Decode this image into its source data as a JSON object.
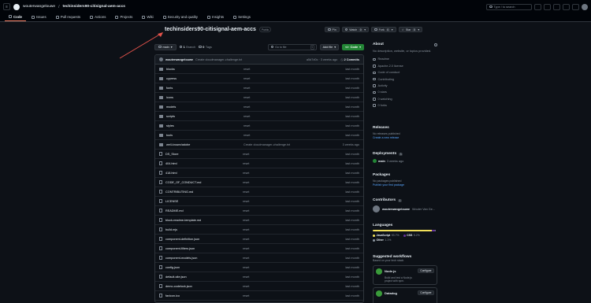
{
  "topbar": {
    "owner": "wouterwangelouwe",
    "repo": "techinsiders90-citisignal-aem-accs",
    "search_placeholder": "Type / to search"
  },
  "tabs": [
    {
      "label": "Code",
      "icon": "code-icon",
      "active": true
    },
    {
      "label": "Issues",
      "icon": "issue-icon"
    },
    {
      "label": "Pull requests",
      "icon": "pull-request-icon"
    },
    {
      "label": "Actions",
      "icon": "actions-icon"
    },
    {
      "label": "Projects",
      "icon": "projects-icon"
    },
    {
      "label": "Wiki",
      "icon": "wiki-icon"
    },
    {
      "label": "Security and quality",
      "icon": "shield-icon"
    },
    {
      "label": "Insights",
      "icon": "graph-icon"
    },
    {
      "label": "Settings",
      "icon": "gear-icon"
    }
  ],
  "repo_header": {
    "title": "techinsiders90-citisignal-aem-accs",
    "visibility": "Public",
    "pin_label": "Pin",
    "watch_label": "Watch",
    "watch_count": "0",
    "fork_label": "Fork",
    "fork_count": "0",
    "star_label": "Star",
    "star_count": "0"
  },
  "controls": {
    "branch": "main",
    "branch_count": "1",
    "branch_word": "Branch",
    "tag_count": "0",
    "tag_word": "Tags",
    "go_to_file": "Go to file",
    "go_to_file_key": "t",
    "add_file": "Add file",
    "code": "Code"
  },
  "latest_commit": {
    "author": "wouterwangelouwe",
    "message": "Create cloudmanager-challenge.txt",
    "hash_time": "a5d7d0c · 3 weeks ago",
    "commits": "2 Commits"
  },
  "files": [
    {
      "name": "blocks",
      "type": "dir",
      "msg": "reset",
      "time": "last month"
    },
    {
      "name": "cypress",
      "type": "dir",
      "msg": "reset",
      "time": "last month"
    },
    {
      "name": "fonts",
      "type": "dir",
      "msg": "reset",
      "time": "last month"
    },
    {
      "name": "icons",
      "type": "dir",
      "msg": "reset",
      "time": "last month"
    },
    {
      "name": "models",
      "type": "dir",
      "msg": "reset",
      "time": "last month"
    },
    {
      "name": "scripts",
      "type": "dir",
      "msg": "reset",
      "time": "last month"
    },
    {
      "name": "styles",
      "type": "dir",
      "msg": "reset",
      "time": "last month"
    },
    {
      "name": "tools",
      "type": "dir",
      "msg": "reset",
      "time": "last month"
    },
    {
      "name": "well-known/adobe",
      "type": "dir",
      "msg": "Create cloudmanager-challenge.txt",
      "time": "3 weeks ago"
    },
    {
      "name": "DS_Store",
      "type": "file",
      "msg": "reset",
      "time": "last month"
    },
    {
      "name": "404.html",
      "type": "file",
      "msg": "reset",
      "time": "last month"
    },
    {
      "name": "418.html",
      "type": "file",
      "msg": "reset",
      "time": "last month"
    },
    {
      "name": "CODE_OF_CONDUCT.md",
      "type": "file",
      "msg": "reset",
      "time": "last month"
    },
    {
      "name": "CONTRIBUTING.md",
      "type": "file",
      "msg": "reset",
      "time": "last month"
    },
    {
      "name": "LICENSE",
      "type": "file",
      "msg": "reset",
      "time": "last month"
    },
    {
      "name": "README.md",
      "type": "file",
      "msg": "reset",
      "time": "last month"
    },
    {
      "name": "block-readme-template.md",
      "type": "file",
      "msg": "reset",
      "time": "last month"
    },
    {
      "name": "build.mjs",
      "type": "file",
      "msg": "reset",
      "time": "last month"
    },
    {
      "name": "component-definition.json",
      "type": "file",
      "msg": "reset",
      "time": "last month"
    },
    {
      "name": "component-filters.json",
      "type": "file",
      "msg": "reset",
      "time": "last month"
    },
    {
      "name": "component-models.json",
      "type": "file",
      "msg": "reset",
      "time": "last month"
    },
    {
      "name": "config.json",
      "type": "file",
      "msg": "reset",
      "time": "last month"
    },
    {
      "name": "default-site.json",
      "type": "file",
      "msg": "reset",
      "time": "last month"
    },
    {
      "name": "demo-codelock.json",
      "type": "file",
      "msg": "reset",
      "time": "last month"
    },
    {
      "name": "favicon.ico",
      "type": "file",
      "msg": "reset",
      "time": "last month"
    }
  ],
  "about": {
    "title": "About",
    "description": "No description, website, or topics provided.",
    "links": [
      {
        "label": "Readme",
        "icon": "book-icon"
      },
      {
        "label": "Apache-2.0 license",
        "icon": "law-icon"
      },
      {
        "label": "Code of conduct",
        "icon": "heart-icon"
      },
      {
        "label": "Contributing",
        "icon": "people-icon"
      },
      {
        "label": "Activity",
        "icon": "pulse-icon"
      },
      {
        "label": "0 stars",
        "icon": "star-icon"
      },
      {
        "label": "0 watching",
        "icon": "eye-icon"
      },
      {
        "label": "0 forks",
        "icon": "fork-icon"
      }
    ]
  },
  "releases": {
    "title": "Releases",
    "none": "No releases published",
    "link": "Create a new release"
  },
  "deployments": {
    "title": "Deployments",
    "count": "3",
    "env": "main",
    "time": "3 weeks ago"
  },
  "packages": {
    "title": "Packages",
    "none": "No packages published",
    "link": "Publish your first package"
  },
  "contributors": {
    "title": "Contributors",
    "count": "1",
    "user": "wouterwangelouwe",
    "name": "Wouter Van Ge..."
  },
  "languages": {
    "title": "Languages",
    "items": [
      {
        "name": "JavaScript",
        "pct": "93.7%",
        "value": 93.7,
        "color": "#f1e05a"
      },
      {
        "name": "CSS",
        "pct": "5.2%",
        "value": 5.2,
        "color": "#663399"
      },
      {
        "name": "Other",
        "pct": "1.1%",
        "value": 1.1,
        "color": "#8b949e"
      }
    ]
  },
  "workflows": {
    "title": "Suggested workflows",
    "subtitle": "Based on your tech stack",
    "items": [
      {
        "name": "Node.js",
        "desc": "Build and test a Node.js project with npm.",
        "button": "Configure"
      },
      {
        "name": "Datadog",
        "desc": "",
        "button": "Configure"
      }
    ]
  },
  "colors": {
    "accent": "#f78166",
    "green": "#238636",
    "link": "#58a6ff"
  }
}
